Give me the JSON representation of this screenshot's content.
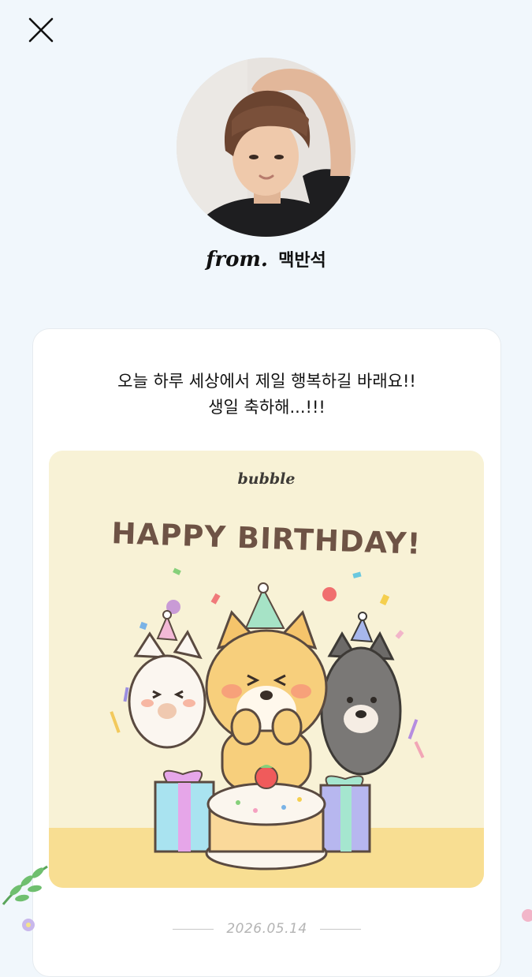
{
  "header": {
    "close_icon": "close-icon",
    "from_prefix": "from.",
    "sender_name": "맥반석"
  },
  "letter": {
    "message_line1": "오늘 하루 세상에서 제일 행복하길 바래요!!",
    "message_line2": "생일 축하해...!!!",
    "card_image": {
      "brand": "bubble",
      "title": "HAPPY BIRTHDAY!"
    },
    "date": "2026.05.14"
  },
  "colors": {
    "background": "#f1f7fc",
    "card_bg": "#ffffff",
    "image_bg": "#f8f2d6",
    "title_brown": "#6e5345"
  }
}
